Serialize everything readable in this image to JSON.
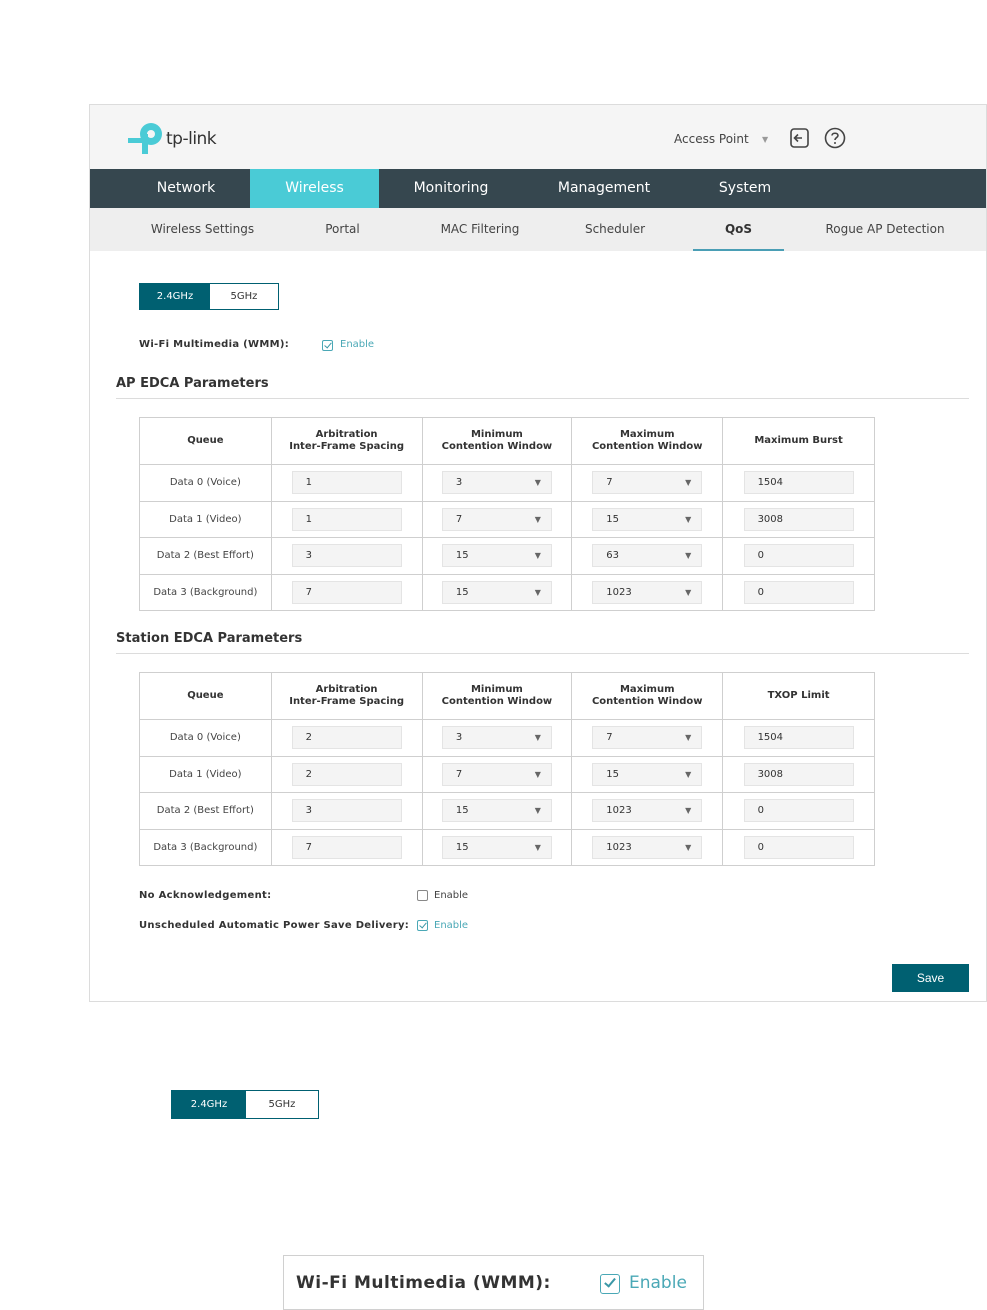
{
  "header": {
    "brand": "tp-link",
    "mode_select": "Access Point"
  },
  "main_nav": [
    "Network",
    "Wireless",
    "Monitoring",
    "Management",
    "System"
  ],
  "main_nav_active": "Wireless",
  "sub_nav": [
    "Wireless Settings",
    "Portal",
    "MAC Filtering",
    "Scheduler",
    "QoS",
    "Rogue AP Detection"
  ],
  "sub_nav_active": "QoS",
  "band_tabs": [
    "2.4GHz",
    "5GHz"
  ],
  "wmm": {
    "label": "Wi-Fi Multimedia (WMM):",
    "enable_label": "Enable",
    "checked": true
  },
  "ap_edca": {
    "title": "AP EDCA Parameters",
    "headers": [
      "Queue",
      "Arbitration",
      "Inter-Frame Spacing",
      "Minimum",
      "Contention Window",
      "Maximum",
      "Contention Window",
      "Maximum Burst"
    ],
    "rows": [
      {
        "queue": "Data 0 (Voice)",
        "aifs": "1",
        "cwmin": "3",
        "cwmax": "7",
        "burst": "1504"
      },
      {
        "queue": "Data 1 (Video)",
        "aifs": "1",
        "cwmin": "7",
        "cwmax": "15",
        "burst": "3008"
      },
      {
        "queue": "Data 2 (Best Effort)",
        "aifs": "3",
        "cwmin": "15",
        "cwmax": "63",
        "burst": "0"
      },
      {
        "queue": "Data 3 (Background)",
        "aifs": "7",
        "cwmin": "15",
        "cwmax": "1023",
        "burst": "0"
      }
    ]
  },
  "station_edca": {
    "title": "Station EDCA Parameters",
    "headers": [
      "Queue",
      "Arbitration",
      "Inter-Frame Spacing",
      "Minimum",
      "Contention Window",
      "Maximum",
      "Contention Window",
      "TXOP Limit"
    ],
    "rows": [
      {
        "queue": "Data 0 (Voice)",
        "aifs": "2",
        "cwmin": "3",
        "cwmax": "7",
        "txop": "1504"
      },
      {
        "queue": "Data 1 (Video)",
        "aifs": "2",
        "cwmin": "7",
        "cwmax": "15",
        "txop": "3008"
      },
      {
        "queue": "Data 2 (Best Effort)",
        "aifs": "3",
        "cwmin": "15",
        "cwmax": "1023",
        "txop": "0"
      },
      {
        "queue": "Data 3 (Background)",
        "aifs": "7",
        "cwmin": "15",
        "cwmax": "1023",
        "txop": "0"
      }
    ]
  },
  "no_ack": {
    "label": "No Acknowledgement:",
    "enable_label": "Enable",
    "checked": false
  },
  "uapsd": {
    "label": "Unscheduled Automatic Power Save Delivery:",
    "enable_label": "Enable",
    "checked": true
  },
  "save_label": "Save",
  "callout_band_tabs": [
    "2.4GHz",
    "5GHz"
  ],
  "callout_wmm": {
    "label": "Wi-Fi Multimedia (WMM):",
    "enable_label": "Enable"
  }
}
